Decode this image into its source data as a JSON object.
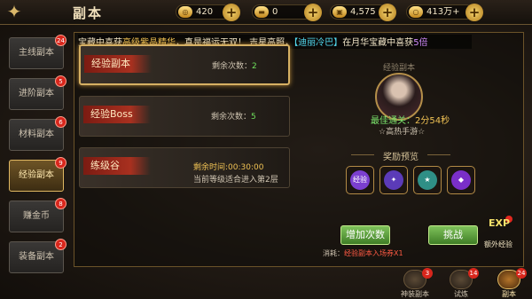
{
  "topbar": {
    "back_icon": "✦",
    "title": "副本",
    "resources": [
      {
        "name": "coin",
        "icon": "◎",
        "value": "420"
      },
      {
        "name": "yuanbao",
        "icon": "▬",
        "value": "0"
      },
      {
        "name": "chest",
        "icon": "▣",
        "value": "4,575"
      },
      {
        "name": "gold",
        "icon": "○",
        "value": "413万+"
      }
    ],
    "plus": "+"
  },
  "tabs": [
    {
      "label": "主线副本",
      "badge": "24"
    },
    {
      "label": "进阶副本",
      "badge": "5"
    },
    {
      "label": "材料副本",
      "badge": "6"
    },
    {
      "label": "经验副本",
      "badge": "9",
      "active": true
    },
    {
      "label": "赚金币",
      "badge": "8"
    },
    {
      "label": "装备副本",
      "badge": "2"
    }
  ],
  "ticker": {
    "p1": "宝藏中喜获",
    "p2": "高级紫晶精华",
    "p3": "，真是福运无双！  吉星高照，",
    "p4": "【迪丽冷巴】",
    "p5": "在月华宝藏中喜获",
    "p6": "5倍"
  },
  "cards": [
    {
      "title": "经验副本",
      "remaining_label": "剩余次数：",
      "remaining": "2"
    },
    {
      "title": "经验Boss",
      "remaining_label": "剩余次数：",
      "remaining": "5"
    },
    {
      "title": "练级谷",
      "time_label": "剩余时间:00:30:00",
      "hint": "当前等级适合进入第2层"
    }
  ],
  "right": {
    "portrait_label": "经验副本",
    "best_label": "最佳通关：",
    "best_time": "2分54秒",
    "player": "☆高热手游☆",
    "reward_title": "奖励预览",
    "rewards": [
      {
        "label": "经验",
        "color": "#7b3fd0"
      },
      {
        "label": "✦",
        "color": "#5b3bb8"
      },
      {
        "label": "★",
        "color": "#2f8f86"
      },
      {
        "label": "◆",
        "color": "#7a2fc8"
      }
    ],
    "add_button": "增加次数",
    "challenge_button": "挑战",
    "consume_label": "消耗：",
    "consume_item": "经验副本入场券X1",
    "exp_icon": "EXP",
    "exp_label": "额外经验"
  },
  "bottom_nav": [
    {
      "label": "神装副本",
      "badge": "3"
    },
    {
      "label": "试炼",
      "badge": "14"
    },
    {
      "label": "副本",
      "badge": "24",
      "active": true
    }
  ]
}
